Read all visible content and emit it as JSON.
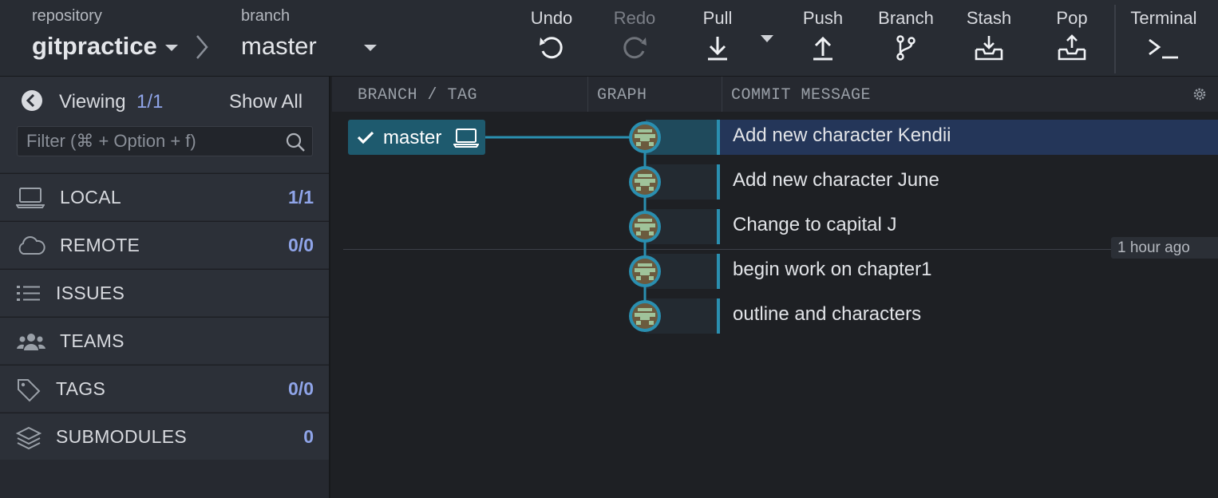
{
  "toolbar": {
    "repository_label": "repository",
    "repository_name": "gitpractice",
    "branch_label": "branch",
    "branch_name": "master",
    "buttons": {
      "undo": "Undo",
      "redo": "Redo",
      "pull": "Pull",
      "push": "Push",
      "branch": "Branch",
      "stash": "Stash",
      "pop": "Pop",
      "terminal": "Terminal"
    }
  },
  "sidebar": {
    "viewing_label": "Viewing",
    "viewing_count": "1/1",
    "show_all": "Show All",
    "filter_placeholder": "Filter (⌘ + Option + f)",
    "sections": [
      {
        "name": "LOCAL",
        "count": "1/1",
        "icon": "laptop-icon"
      },
      {
        "name": "REMOTE",
        "count": "0/0",
        "icon": "cloud-icon"
      },
      {
        "name": "ISSUES",
        "count": "",
        "icon": "list-icon"
      },
      {
        "name": "TEAMS",
        "count": "",
        "icon": "team-icon"
      },
      {
        "name": "TAGS",
        "count": "0/0",
        "icon": "tag-icon"
      },
      {
        "name": "SUBMODULES",
        "count": "0",
        "icon": "layers-icon"
      }
    ]
  },
  "graph": {
    "columns": {
      "branch_tag": "BRANCH / TAG",
      "graph": "GRAPH",
      "commit_message": "COMMIT MESSAGE"
    },
    "branch_tag_label": "master",
    "commits": [
      {
        "message": "Add new character Kendii",
        "selected": true
      },
      {
        "message": "Add new character June",
        "selected": false
      },
      {
        "message": "Change to capital J",
        "selected": false
      },
      {
        "message": "begin work on chapter1",
        "selected": false
      },
      {
        "message": "outline and characters",
        "selected": false
      }
    ],
    "time_marker": "1 hour ago",
    "colors": {
      "accent": "#2a8fb0",
      "selected_row": "#243659",
      "branch_tag": "#1e5a6e",
      "count_text": "#8fa4e8"
    }
  }
}
